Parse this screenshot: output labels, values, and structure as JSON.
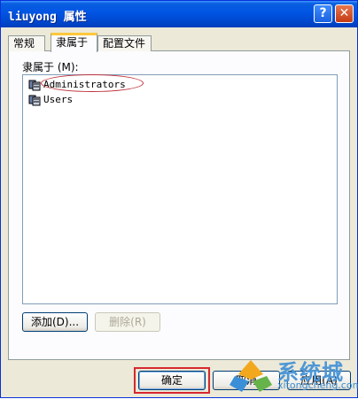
{
  "window": {
    "title": "liuyong 属性"
  },
  "titlebar": {
    "help_glyph": "?",
    "close_glyph": "✕"
  },
  "tabs": [
    {
      "label": "常规",
      "active": false
    },
    {
      "label": "隶属于",
      "active": true
    },
    {
      "label": "配置文件",
      "active": false
    }
  ],
  "member_of": {
    "label": "隶属于 (M):",
    "items": [
      {
        "name": "Administrators",
        "icon": "group-icon"
      },
      {
        "name": "Users",
        "icon": "group-icon"
      }
    ]
  },
  "buttons": {
    "add": "添加(D)...",
    "remove": "删除(R)",
    "ok": "确定",
    "cancel": "取消",
    "apply": "应用(A)"
  },
  "watermark": {
    "text": "系统城",
    "url": "xitongcheng.com"
  },
  "colors": {
    "titlebar": "#0054e3",
    "active_tab_accent": "#ffc83c",
    "highlight_red": "#d6282f",
    "watermark_blue": "#4d97d6"
  }
}
